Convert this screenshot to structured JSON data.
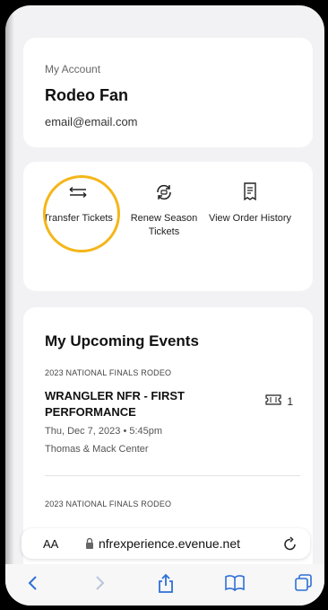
{
  "account": {
    "label": "My Account",
    "name": "Rodeo Fan",
    "email": "email@email.com"
  },
  "actions": [
    {
      "label": "Transfer Tickets",
      "icon": "transfer-arrows-icon"
    },
    {
      "label": "Renew Season Tickets",
      "icon": "renew-ticket-icon"
    },
    {
      "label": "View Order History",
      "icon": "receipt-icon"
    }
  ],
  "events": {
    "title": "My Upcoming Events",
    "items": [
      {
        "series": "2023 NATIONAL FINALS RODEO",
        "name": "WRANGLER NFR - FIRST PERFORMANCE",
        "date": "Thu, Dec 7, 2023 • 5:45pm",
        "venue": "Thomas & Mack Center",
        "ticket_count": "1"
      },
      {
        "series": "2023 NATIONAL FINALS RODEO"
      }
    ]
  },
  "browser": {
    "aa_label": "AA",
    "url": "nfrexperience.evenue.net"
  },
  "colors": {
    "highlight": "#f4b61a",
    "link": "#2f6fd6"
  }
}
